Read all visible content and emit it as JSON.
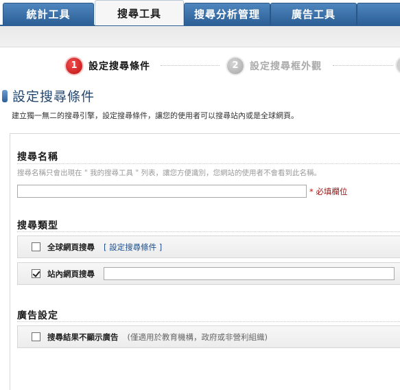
{
  "tabs": [
    {
      "label": "統計工具",
      "active": false
    },
    {
      "label": "搜尋工具",
      "active": true
    },
    {
      "label": "搜尋分析管理",
      "active": false
    },
    {
      "label": "廣告工具",
      "active": false
    }
  ],
  "steps": [
    {
      "number": "1",
      "label": "設定搜尋條件",
      "current": true
    },
    {
      "number": "2",
      "label": "設定搜尋框外觀",
      "current": false
    }
  ],
  "page": {
    "title": "設定搜尋條件",
    "description": "建立獨一無二的搜尋引擎，設定搜尋條件，讓您的使用者可以搜尋站內或是全球網頁。"
  },
  "search_name": {
    "heading": "搜尋名稱",
    "hint": "搜尋名稱只會出現在 \" 我的搜尋工具 \" 列表，讓您方便識別，您網站的使用者不會看到此名稱。",
    "value": "",
    "required_star": "*",
    "required_text": "必填欄位"
  },
  "search_type": {
    "heading": "搜尋類型",
    "options": [
      {
        "label": "全球網頁搜尋",
        "checked": false,
        "link": "[ 設定搜尋條件 ]"
      },
      {
        "label": "站內網頁搜尋",
        "checked": true,
        "value": ""
      }
    ]
  },
  "ad_settings": {
    "heading": "廣告設定",
    "option_label": "搜尋結果不顯示廣告",
    "option_checked": false,
    "option_note": "(僅適用於教育機構，政府或非營利組織)"
  },
  "colors": {
    "tab_blue": "#2c5f96",
    "title_blue": "#23466f",
    "required_red": "#9a1010",
    "step_active_red": "#c01010"
  },
  "icons": [
    "checkbox-icon",
    "checkmark-icon"
  ]
}
